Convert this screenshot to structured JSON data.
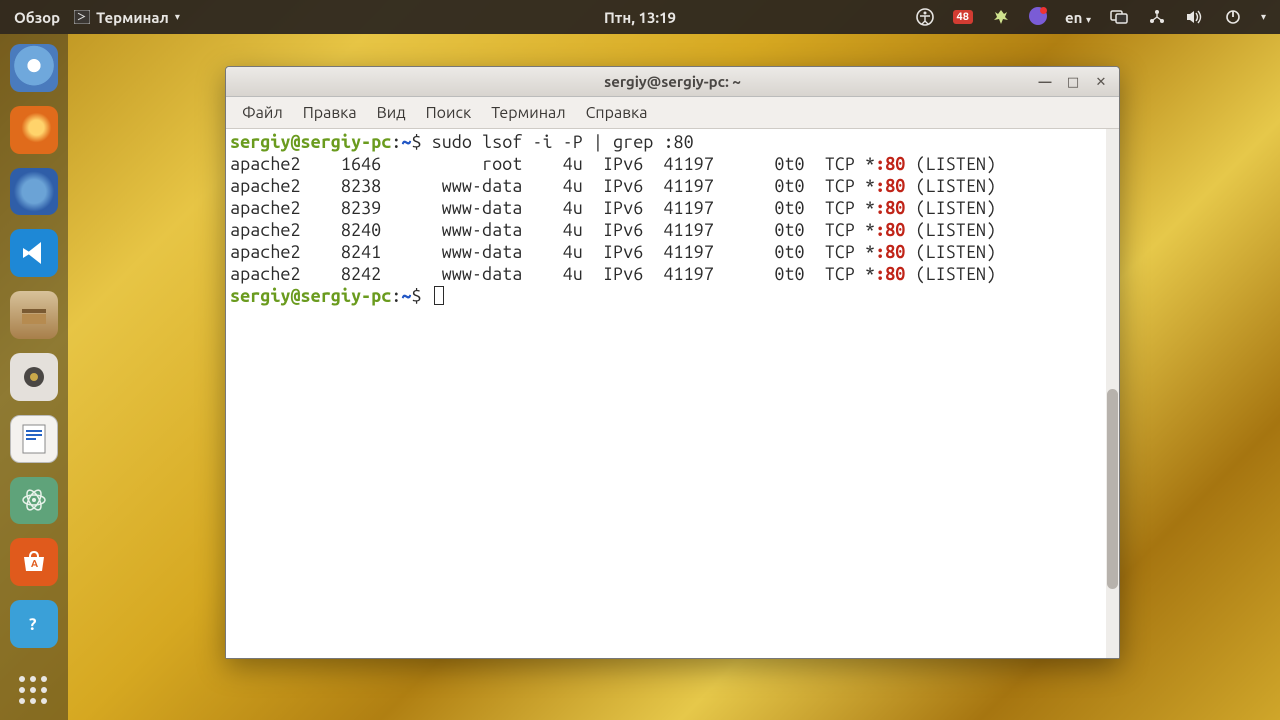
{
  "top": {
    "overview": "Обзор",
    "app_name": "Терминал",
    "clock": "Птн, 13:19",
    "badge": "48",
    "lang": "en"
  },
  "dock": {
    "items": [
      {
        "name": "chromium",
        "color": "#6fa8dc"
      },
      {
        "name": "firefox",
        "color": "#e06b1b"
      },
      {
        "name": "thunderbird",
        "color": "#2f5ea8"
      },
      {
        "name": "vscode",
        "color": "#1e88d6"
      },
      {
        "name": "files",
        "color": "#c79b5a"
      },
      {
        "name": "rhythmbox",
        "color": "#d9d4cd"
      },
      {
        "name": "writer",
        "color": "#2563c4"
      },
      {
        "name": "atom",
        "color": "#5fa37a"
      },
      {
        "name": "software",
        "color": "#e05a1c"
      },
      {
        "name": "help",
        "color": "#3aa0d8"
      }
    ]
  },
  "window": {
    "title": "sergiy@sergiy-pc: ~",
    "menus": [
      "Файл",
      "Правка",
      "Вид",
      "Поиск",
      "Терминал",
      "Справка"
    ]
  },
  "terminal": {
    "prompt_user": "sergiy@sergiy-pc",
    "prompt_sep": ":",
    "prompt_path": "~",
    "prompt_sym": "$",
    "command": "sudo lsof -i -P | grep :80",
    "rows": [
      {
        "proc": "apache2",
        "pid": "1646",
        "user": "root",
        "fd": "4u",
        "type": "IPv6",
        "node": "41197",
        "sz": "0t0",
        "proto": "TCP *",
        "port": ":80",
        "state": "(LISTEN)"
      },
      {
        "proc": "apache2",
        "pid": "8238",
        "user": "www-data",
        "fd": "4u",
        "type": "IPv6",
        "node": "41197",
        "sz": "0t0",
        "proto": "TCP *",
        "port": ":80",
        "state": "(LISTEN)"
      },
      {
        "proc": "apache2",
        "pid": "8239",
        "user": "www-data",
        "fd": "4u",
        "type": "IPv6",
        "node": "41197",
        "sz": "0t0",
        "proto": "TCP *",
        "port": ":80",
        "state": "(LISTEN)"
      },
      {
        "proc": "apache2",
        "pid": "8240",
        "user": "www-data",
        "fd": "4u",
        "type": "IPv6",
        "node": "41197",
        "sz": "0t0",
        "proto": "TCP *",
        "port": ":80",
        "state": "(LISTEN)"
      },
      {
        "proc": "apache2",
        "pid": "8241",
        "user": "www-data",
        "fd": "4u",
        "type": "IPv6",
        "node": "41197",
        "sz": "0t0",
        "proto": "TCP *",
        "port": ":80",
        "state": "(LISTEN)"
      },
      {
        "proc": "apache2",
        "pid": "8242",
        "user": "www-data",
        "fd": "4u",
        "type": "IPv6",
        "node": "41197",
        "sz": "0t0",
        "proto": "TCP *",
        "port": ":80",
        "state": "(LISTEN)"
      }
    ]
  }
}
